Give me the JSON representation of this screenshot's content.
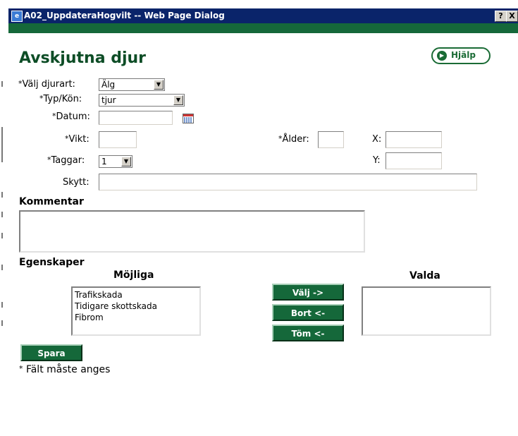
{
  "window": {
    "title": "A02_UppdateraHogvilt -- Web Page Dialog",
    "help_btn": "?",
    "close_btn": "X"
  },
  "page": {
    "title": "Avskjutna djur",
    "help_label": "Hjälp"
  },
  "required_marker": "*",
  "form": {
    "djurart": {
      "label": "Välj djurart:",
      "value": "Älg"
    },
    "typ_kon": {
      "label": "Typ/Kön:",
      "value": "tjur"
    },
    "datum": {
      "label": "Datum:",
      "value": ""
    },
    "vikt": {
      "label": "Vikt:",
      "value": ""
    },
    "alder": {
      "label": "Ålder:",
      "value": ""
    },
    "x": {
      "label": "X:",
      "value": ""
    },
    "taggar": {
      "label": "Taggar:",
      "value": "1"
    },
    "y": {
      "label": "Y:",
      "value": ""
    },
    "skytt": {
      "label": "Skytt:",
      "value": ""
    }
  },
  "kommentar": {
    "heading": "Kommentar",
    "value": ""
  },
  "egenskaper": {
    "heading": "Egenskaper",
    "possible_heading": "Möjliga",
    "selected_heading": "Valda",
    "possible": [
      "Trafikskada",
      "Tidigare skottskada",
      "Fibrom"
    ],
    "selected": [],
    "buttons": {
      "select": "Välj ->",
      "remove": "Bort <-",
      "clear": "Töm <-"
    }
  },
  "save_label": "Spara",
  "footnote": "Fält måste anges"
}
